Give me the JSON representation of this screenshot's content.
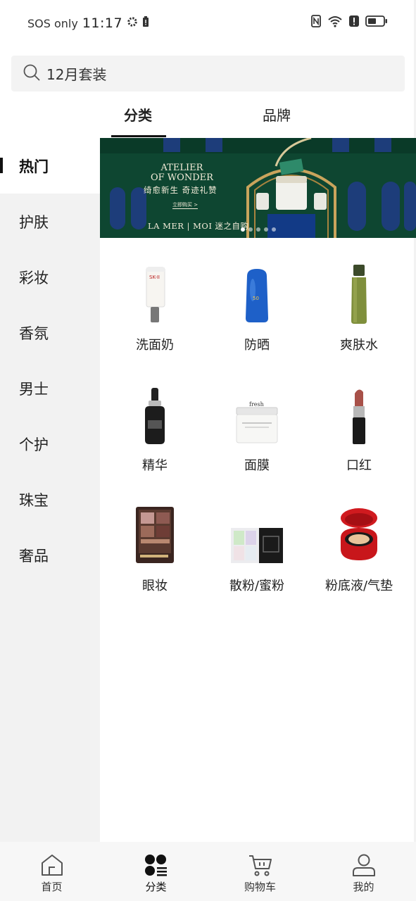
{
  "status": {
    "sos": "SOS only",
    "time": "11:17"
  },
  "search": {
    "query": "12月套装"
  },
  "tabs": [
    "分类",
    "品牌"
  ],
  "sidebar": {
    "items": [
      "热门",
      "护肤",
      "彩妆",
      "香氛",
      "男士",
      "个护",
      "珠宝",
      "奢品"
    ],
    "active_index": 0
  },
  "banner": {
    "title_line1": "ATELIER",
    "title_line2": "OF WONDER",
    "subtitle": "绮愈新生 奇迹礼赞",
    "cta": "立即购买 >",
    "brand": "LA MER | MOI 迷之自购",
    "slide_count": 5,
    "active_slide": 0
  },
  "categories": [
    {
      "label": "洗面奶",
      "icon": "cleanser-tube-icon"
    },
    {
      "label": "防晒",
      "icon": "sunscreen-bottle-icon"
    },
    {
      "label": "爽肤水",
      "icon": "toner-bottle-icon"
    },
    {
      "label": "精华",
      "icon": "serum-bottle-icon"
    },
    {
      "label": "面膜",
      "icon": "face-mask-jar-icon"
    },
    {
      "label": "口红",
      "icon": "lipstick-icon"
    },
    {
      "label": "眼妆",
      "icon": "eyeshadow-palette-icon"
    },
    {
      "label": "散粉/蜜粉",
      "icon": "loose-powder-icon"
    },
    {
      "label": "粉底液/气垫",
      "icon": "cushion-compact-icon"
    }
  ],
  "bottom_nav": {
    "items": [
      {
        "label": "首页",
        "icon": "home-icon"
      },
      {
        "label": "分类",
        "icon": "category-icon"
      },
      {
        "label": "购物车",
        "icon": "cart-icon"
      },
      {
        "label": "我的",
        "icon": "profile-icon"
      }
    ],
    "active_index": 1
  },
  "colors": {
    "accent": "#111111",
    "sidebar_bg": "#f2f2f2",
    "banner_green": "#0f4a34",
    "gold": "#c9a45c"
  }
}
